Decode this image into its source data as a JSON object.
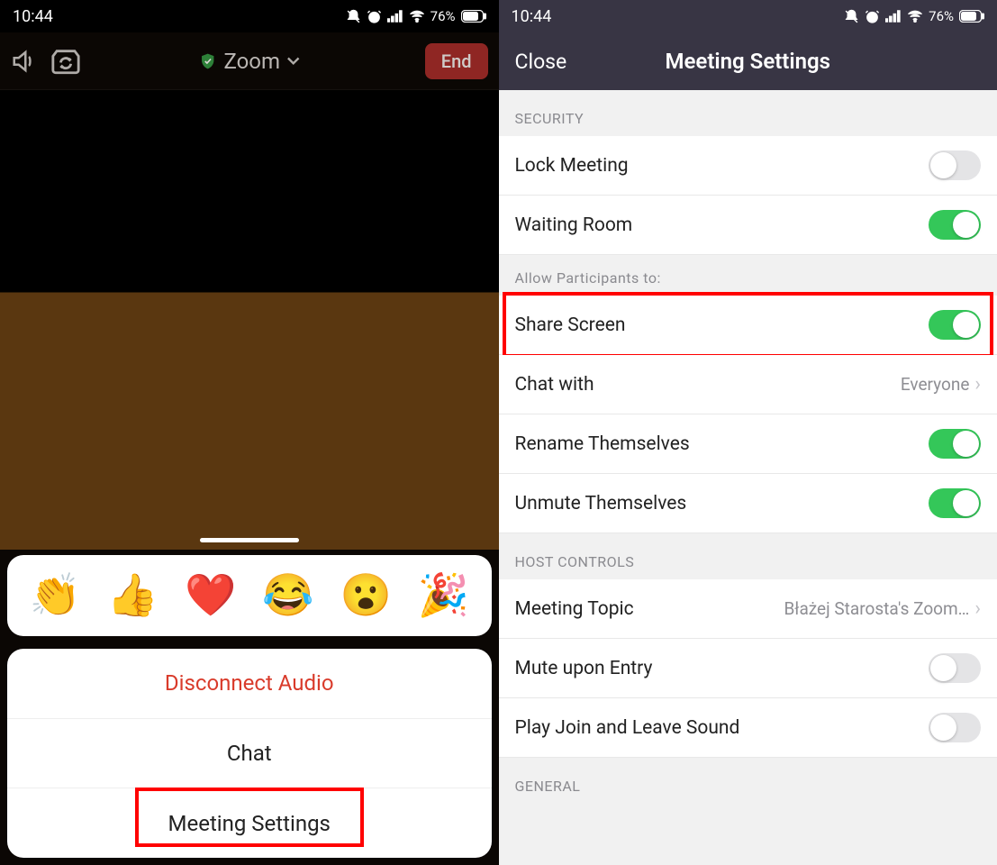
{
  "status": {
    "time": "10:44",
    "battery": "76%"
  },
  "left": {
    "app_title": "Zoom",
    "end_label": "End",
    "emojis": [
      "👏",
      "👍",
      "❤️",
      "😂",
      "😮",
      "🎉"
    ],
    "menu": {
      "disconnect": "Disconnect Audio",
      "chat": "Chat",
      "meeting_settings": "Meeting Settings"
    }
  },
  "right": {
    "close": "Close",
    "title": "Meeting Settings",
    "sections": {
      "security": "SECURITY",
      "allow": "Allow Participants to:",
      "host_controls": "HOST CONTROLS",
      "general": "GENERAL"
    },
    "rows": {
      "lock_meeting": {
        "label": "Lock Meeting",
        "on": false
      },
      "waiting_room": {
        "label": "Waiting Room",
        "on": true
      },
      "share_screen": {
        "label": "Share Screen",
        "on": true
      },
      "chat_with": {
        "label": "Chat with",
        "value": "Everyone"
      },
      "rename": {
        "label": "Rename Themselves",
        "on": true
      },
      "unmute": {
        "label": "Unmute Themselves",
        "on": true
      },
      "meeting_topic": {
        "label": "Meeting Topic",
        "value": "Błażej Starosta's Zoom…"
      },
      "mute_entry": {
        "label": "Mute upon Entry",
        "on": false
      },
      "play_sound": {
        "label": "Play Join and Leave Sound",
        "on": false
      }
    }
  }
}
